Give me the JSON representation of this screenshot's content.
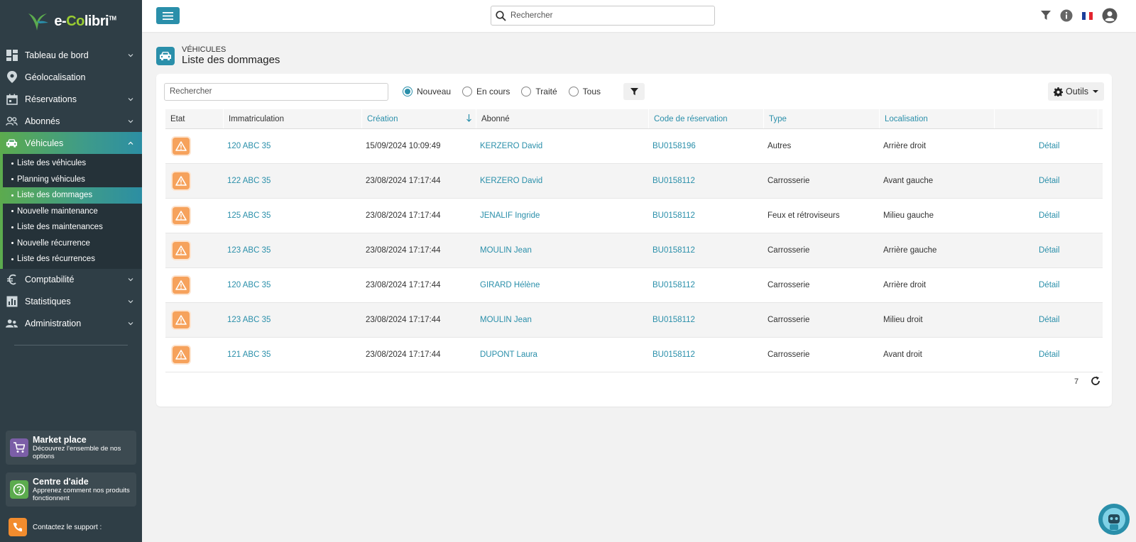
{
  "app": {
    "logo_text_pre": "e-",
    "logo_text_co": "Co",
    "logo_text_post": "libri",
    "logo_tm": "TM"
  },
  "colors": {
    "primary": "#2a8faa",
    "green": "#5cab4e",
    "sidebar": "#2f3e46",
    "warning": "#f6a25c",
    "support": "#f28c2e"
  },
  "topbar": {
    "search_placeholder": "Rechercher",
    "icons": [
      "menu-icon",
      "search-icon",
      "filter-icon",
      "info-icon",
      "french-flag-icon",
      "user-account-icon"
    ]
  },
  "sidebar": {
    "items": [
      {
        "label": "Tableau de bord",
        "icon": "dashboard-icon",
        "expandable": true
      },
      {
        "label": "Géolocalisation",
        "icon": "location-pin-icon",
        "expandable": false
      },
      {
        "label": "Réservations",
        "icon": "calendar-icon",
        "expandable": true
      },
      {
        "label": "Abonnés",
        "icon": "users-icon",
        "expandable": true
      },
      {
        "label": "Véhicules",
        "icon": "car-icon",
        "expandable": true,
        "active": true
      },
      {
        "label": "Comptabilité",
        "icon": "euro-icon",
        "expandable": true
      },
      {
        "label": "Statistiques",
        "icon": "chart-icon",
        "expandable": true
      },
      {
        "label": "Administration",
        "icon": "admin-users-icon",
        "expandable": true
      }
    ],
    "vehicle_subitems": [
      "Liste des véhicules",
      "Planning véhicules",
      "Liste des dommages",
      "Nouvelle maintenance",
      "Liste des maintenances",
      "Nouvelle récurrence",
      "Liste des récurrences"
    ],
    "market": {
      "title": "Market place",
      "subtitle": "Découvrez l'ensemble de nos options"
    },
    "help": {
      "title": "Centre d'aide",
      "subtitle": "Apprenez comment nos produits fonctionnent"
    },
    "support": "Contactez le support :"
  },
  "page": {
    "kicker": "VÉHICULES",
    "title": "Liste des dommages"
  },
  "filters": {
    "search_placeholder": "Rechercher",
    "status_options": [
      "Nouveau",
      "En cours",
      "Traité",
      "Tous"
    ],
    "selected": "Nouveau",
    "tools_label": "Outils"
  },
  "table": {
    "columns": [
      "Etat",
      "Immatriculation",
      "Création",
      "Abonné",
      "Code de réservation",
      "Type",
      "Localisation",
      ""
    ],
    "sorted_column": "Création",
    "sort_direction": "descending",
    "rows": [
      {
        "plate": "120 ABC 35",
        "created": "15/09/2024 10:09:49",
        "subscriber": "KERZERO David",
        "booking": "BU0158196",
        "type": "Autres",
        "location": "Arrière droit",
        "action": "Détail"
      },
      {
        "plate": "122 ABC 35",
        "created": "23/08/2024 17:17:44",
        "subscriber": "KERZERO David",
        "booking": "BU0158112",
        "type": "Carrosserie",
        "location": "Avant gauche",
        "action": "Détail"
      },
      {
        "plate": "125 ABC 35",
        "created": "23/08/2024 17:17:44",
        "subscriber": "JENALIF Ingride",
        "booking": "BU0158112",
        "type": "Feux et rétroviseurs",
        "location": "Milieu gauche",
        "action": "Détail"
      },
      {
        "plate": "123 ABC 35",
        "created": "23/08/2024 17:17:44",
        "subscriber": "MOULIN Jean",
        "booking": "BU0158112",
        "type": "Carrosserie",
        "location": "Arrière gauche",
        "action": "Détail"
      },
      {
        "plate": "120 ABC 35",
        "created": "23/08/2024 17:17:44",
        "subscriber": "GIRARD Hélène",
        "booking": "BU0158112",
        "type": "Carrosserie",
        "location": "Arrière droit",
        "action": "Détail"
      },
      {
        "plate": "123 ABC 35",
        "created": "23/08/2024 17:17:44",
        "subscriber": "MOULIN Jean",
        "booking": "BU0158112",
        "type": "Carrosserie",
        "location": "Milieu droit",
        "action": "Détail"
      },
      {
        "plate": "121 ABC 35",
        "created": "23/08/2024 17:17:44",
        "subscriber": "DUPONT Laura",
        "booking": "BU0158112",
        "type": "Carrosserie",
        "location": "Avant droit",
        "action": "Détail"
      }
    ],
    "total_count": "7"
  }
}
